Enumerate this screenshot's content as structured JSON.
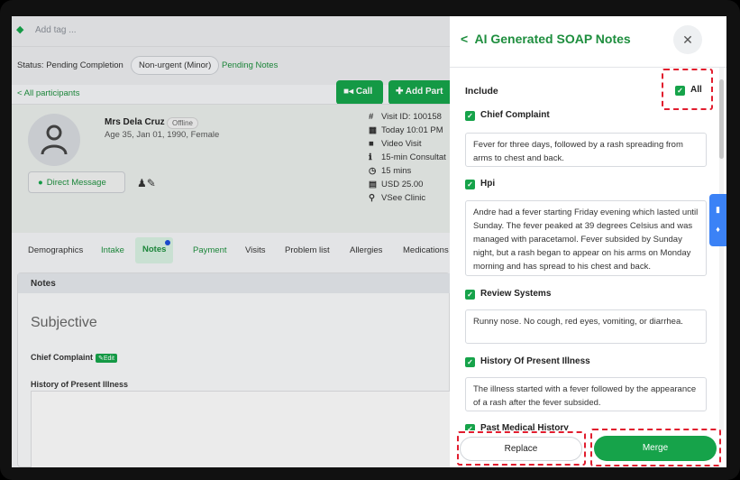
{
  "tag": {
    "placeholder": "Add tag ..."
  },
  "status": {
    "label": "Status: Pending Completion",
    "urgency": "Non-urgent (Minor)",
    "pending_notes": "Pending Notes"
  },
  "actions": {
    "call": "Call",
    "add_participant": "Add Part"
  },
  "breadcrumb": "< All participants",
  "patient": {
    "name": "Mrs Dela Cruz",
    "presence": "Offline",
    "details": "Age 35, Jan 01, 1990, Female",
    "direct_message": "Direct Message",
    "visit": [
      {
        "icon": "#",
        "text": "Visit ID: 100158"
      },
      {
        "icon": "▦",
        "text": "Today 10:01 PM"
      },
      {
        "icon": "■",
        "text": "Video Visit"
      },
      {
        "icon": "ℹ",
        "text": "15-min Consultat"
      },
      {
        "icon": "◷",
        "text": "15 mins"
      },
      {
        "icon": "▤",
        "text": "USD 25.00"
      },
      {
        "icon": "⚲",
        "text": "VSee Clinic"
      }
    ]
  },
  "tabs": [
    {
      "label": "Demographics",
      "style": "plain"
    },
    {
      "label": "Intake",
      "style": "green"
    },
    {
      "label": "Notes",
      "style": "active"
    },
    {
      "label": "Payment",
      "style": "green"
    },
    {
      "label": "Visits",
      "style": "plain"
    },
    {
      "label": "Problem list",
      "style": "plain"
    },
    {
      "label": "Allergies",
      "style": "plain"
    },
    {
      "label": "Medications",
      "style": "plain"
    }
  ],
  "notes": {
    "header": "Notes",
    "section": "Subjective",
    "chief_complaint": "Chief Complaint",
    "edit": "Edit",
    "hopi": "History of Present Illness"
  },
  "panel": {
    "title": "AI Generated SOAP Notes",
    "back": "<",
    "close": "✕",
    "include": "Include",
    "all": "All",
    "sections": [
      {
        "title": "Chief Complaint",
        "text": "Fever for three days, followed by a rash spreading from arms to chest and back."
      },
      {
        "title": "Hpi",
        "text": "Andre had a fever starting Friday evening which lasted until Sunday. The fever peaked at 39 degrees Celsius and was managed with paracetamol. Fever subsided by Sunday night, but a rash began to appear on his arms on Monday morning and has spread to his chest and back."
      },
      {
        "title": "Review Systems",
        "text": "Runny nose. No cough, red eyes, vomiting, or diarrhea."
      },
      {
        "title": "History Of Present Illness",
        "text": "The illness started with a fever followed by the appearance of a rash after the fever subsided."
      }
    ],
    "next_section": "Past Medical History",
    "replace": "Replace",
    "merge": "Merge"
  },
  "colors": {
    "accent": "#16a34a",
    "annotation": "#e11d2e",
    "side_tab": "#3b82f6"
  }
}
